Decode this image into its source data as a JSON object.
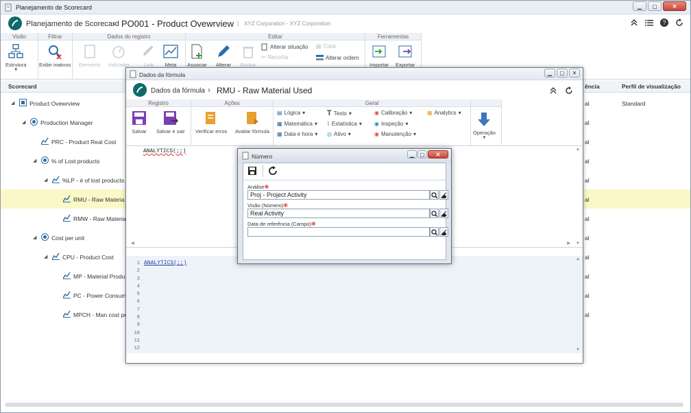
{
  "window": {
    "title": "Planejamento de Scorecard"
  },
  "header": {
    "app": "Planejamento de Scorecard",
    "title": "PO001 - Product Ovewrview",
    "corp": "XYZ Corporation - XYZ Corporation"
  },
  "ribbon": {
    "groups": {
      "visao": "Visão",
      "filtrar": "Filtrar",
      "dados": "Dados do registro",
      "editar": "Editar",
      "ferramentas": "Ferramentas"
    },
    "estrutura": "Estrutura",
    "exibir_inativos": "Exibir inativos",
    "elemento": "Elemento",
    "indicador": "Indicador",
    "link": "Link",
    "meta": "Meta",
    "associar": "Associar",
    "alterar": "Alterar",
    "excluir": "Excluir",
    "alterar_situacao": "Alterar situação",
    "recortar": "Recortar",
    "colar": "Colar",
    "alterar_ordem": "Alterar ordem",
    "importar": "Importar",
    "exportar": "Exportar"
  },
  "grid": {
    "col_scorecard": "Scorecard",
    "col_referencia": "ência",
    "col_perfil": "Perfil de visualização",
    "perfil_value": "Standard",
    "ref_suffix": "al",
    "rows": [
      {
        "label": "Product Ovewrview"
      },
      {
        "label": "Production Manager"
      },
      {
        "label": "PRC - Product Real Cost"
      },
      {
        "label": "% of Lost products"
      },
      {
        "label": "%LP - # of lost products"
      },
      {
        "label": "RMU - Raw Materia"
      },
      {
        "label": "RMW - Raw Materia"
      },
      {
        "label": "Cost per unit"
      },
      {
        "label": "CPU - Product Cost"
      },
      {
        "label": "MP - Material Produ"
      },
      {
        "label": "PC - Power Consum"
      },
      {
        "label": "MPCH - Man cost pe"
      }
    ]
  },
  "formula": {
    "window_title": "Dados da fórmula",
    "app": "Dados da fórmula",
    "title": "RMU - Raw Material Used",
    "groups": {
      "registro": "Registro",
      "acoes": "Ações",
      "geral": "Geral"
    },
    "salvar": "Salvar",
    "salvar_sair": "Salvar e sair",
    "verificar": "Verificar erros",
    "avaliar": "Avaliar fórmula",
    "menus": {
      "logica": "Lógica",
      "matematica": "Matemática",
      "data_hora": "Data e hora",
      "texto": "Texto",
      "estatistica": "Estatística",
      "ativo": "Ativo",
      "calibracao": "Calibração",
      "inspecao": "Inspeção",
      "manutencao": "Manutenção",
      "analytics": "Analytics",
      "operacao": "Operação"
    },
    "code_top": "ANALYTICS(;;)",
    "code_bottom": "ANALYTICS(;;)",
    "line_numbers": [
      "1",
      "2",
      "3",
      "4",
      "5",
      "6",
      "7",
      "8",
      "9",
      "10",
      "11",
      "12"
    ]
  },
  "numero": {
    "title": "Número",
    "analise_label": "Análise",
    "analise_value": "Proj - Project Activity",
    "visao_label": "Visão (Número)",
    "visao_value": "Real Activity",
    "data_label": "Data de referência (Campo)",
    "data_value": ""
  }
}
